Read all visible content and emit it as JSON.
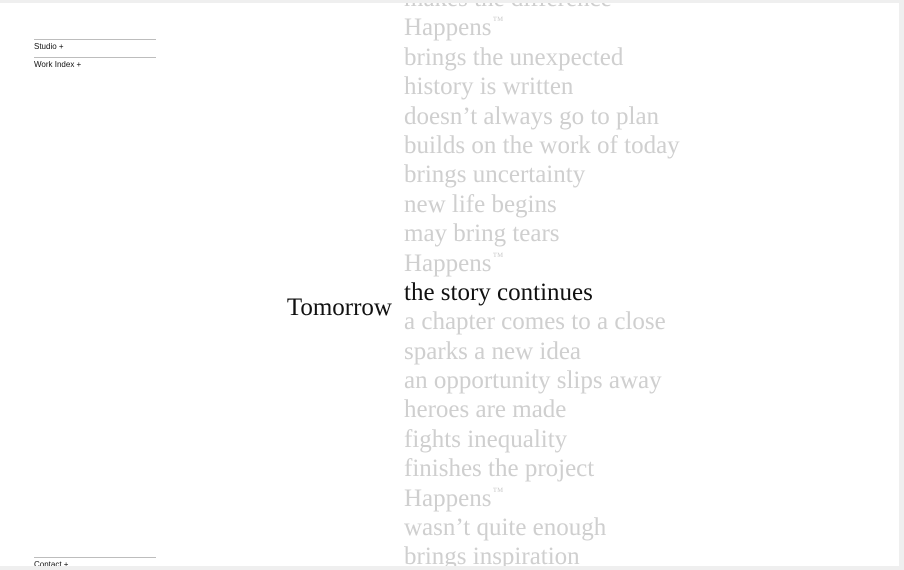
{
  "nav": {
    "studio_label": "Studio +",
    "work_index_label": "Work Index +",
    "contact_label": "Contact +"
  },
  "hero": {
    "lead_word": "Tomorrow",
    "trademark_symbol": "™",
    "phrases": [
      "makes the difference",
      "Happens",
      "brings the unexpected",
      "history is written",
      "doesn’t always go to plan",
      "builds on the work of today",
      "brings uncertainty",
      "new life begins",
      "may bring tears",
      "Happens",
      "the story continues",
      "a chapter comes to a close",
      "sparks a new idea",
      "an opportunity slips away",
      "heroes are made",
      "fights inequality",
      "finishes the project",
      "Happens",
      "wasn’t quite enough",
      "brings inspiration"
    ],
    "trademarked_phrase_indexes": [
      1,
      9,
      17
    ],
    "active_phrase_index": 10
  },
  "colors": {
    "text_primary": "#111111",
    "text_faded": "#cfcfcf",
    "background": "#ffffff"
  }
}
